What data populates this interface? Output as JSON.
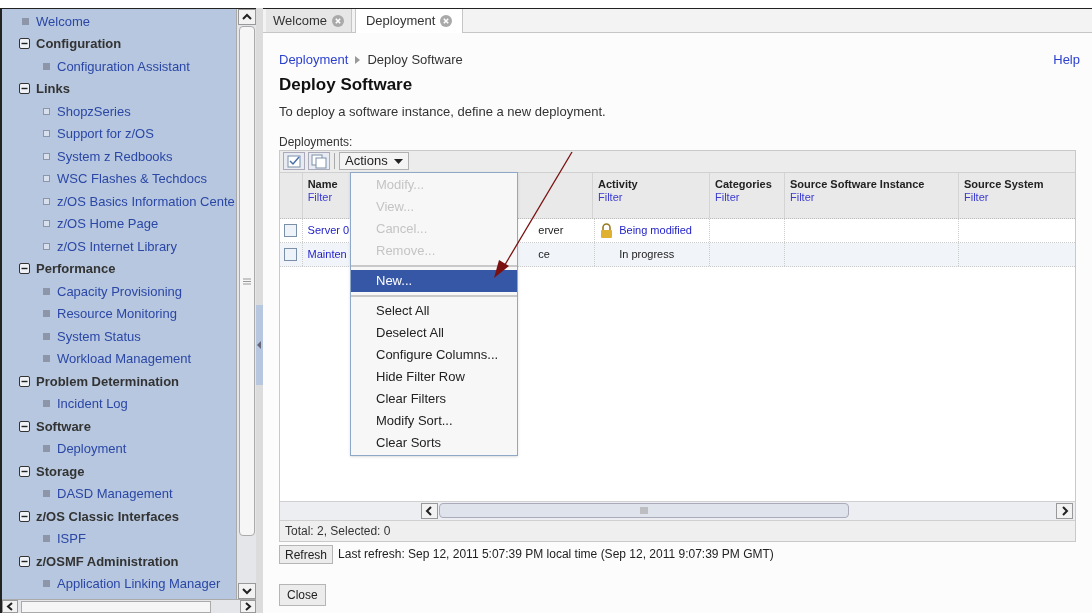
{
  "sidebar": {
    "items": [
      {
        "kind": "page",
        "label": "Welcome"
      },
      {
        "kind": "group",
        "label": "Configuration",
        "expanded": true,
        "children": [
          {
            "kind": "page",
            "label": "Configuration Assistant"
          }
        ]
      },
      {
        "kind": "group",
        "label": "Links",
        "expanded": true,
        "children": [
          {
            "kind": "link",
            "label": "ShopzSeries"
          },
          {
            "kind": "link",
            "label": "Support for z/OS"
          },
          {
            "kind": "link",
            "label": "System z Redbooks"
          },
          {
            "kind": "link",
            "label": "WSC Flashes & Techdocs"
          },
          {
            "kind": "link",
            "label": "z/OS Basics Information Cente"
          },
          {
            "kind": "link",
            "label": "z/OS Home Page"
          },
          {
            "kind": "link",
            "label": "z/OS Internet Library"
          }
        ]
      },
      {
        "kind": "group",
        "label": "Performance",
        "expanded": true,
        "children": [
          {
            "kind": "page",
            "label": "Capacity Provisioning"
          },
          {
            "kind": "page",
            "label": "Resource Monitoring"
          },
          {
            "kind": "page",
            "label": "System Status"
          },
          {
            "kind": "page",
            "label": "Workload Management"
          }
        ]
      },
      {
        "kind": "group",
        "label": "Problem Determination",
        "expanded": true,
        "children": [
          {
            "kind": "page",
            "label": "Incident Log"
          }
        ]
      },
      {
        "kind": "group",
        "label": "Software",
        "expanded": true,
        "children": [
          {
            "kind": "page",
            "label": "Deployment"
          }
        ]
      },
      {
        "kind": "group",
        "label": "Storage",
        "expanded": true,
        "children": [
          {
            "kind": "page",
            "label": "DASD Management"
          }
        ]
      },
      {
        "kind": "group",
        "label": "z/OS Classic Interfaces",
        "expanded": true,
        "children": [
          {
            "kind": "page",
            "label": "ISPF"
          }
        ]
      },
      {
        "kind": "group",
        "label": "z/OSMF Administration",
        "expanded": true,
        "children": [
          {
            "kind": "page",
            "label": "Application Linking Manager"
          }
        ]
      }
    ]
  },
  "tabs": [
    {
      "label": "Welcome",
      "selected": false
    },
    {
      "label": "Deployment",
      "selected": true
    }
  ],
  "breadcrumb": {
    "parent": "Deployment",
    "current": "Deploy Software"
  },
  "help": "Help",
  "title": "Deploy Software",
  "description": "To deploy a software instance, define a new deployment.",
  "table": {
    "label": "Deployments:",
    "actions": "Actions",
    "columns": [
      {
        "label": "Name",
        "filter": "Filter"
      },
      {
        "label": "Activity",
        "filter": "Filter"
      },
      {
        "label": "Categories",
        "filter": "Filter"
      },
      {
        "label": "Source Software Instance",
        "filter": "Filter"
      },
      {
        "label": "Source System",
        "filter": "Filter"
      }
    ],
    "rows": [
      {
        "selected": false,
        "name": "Server 0",
        "column_2": "erver",
        "activity": "Being modified",
        "locked": true
      },
      {
        "selected": false,
        "name": "Mainten",
        "column_2": "ce",
        "activity": "In progress",
        "locked": false
      }
    ],
    "status": "Total: 2, Selected: 0"
  },
  "menu": {
    "items": [
      {
        "kind": "item",
        "label": "Modify...",
        "disabled": true,
        "selected": false
      },
      {
        "kind": "item",
        "label": "View...",
        "disabled": true,
        "selected": false
      },
      {
        "kind": "item",
        "label": "Cancel...",
        "disabled": true,
        "selected": false
      },
      {
        "kind": "item",
        "label": "Remove...",
        "disabled": true,
        "selected": false
      },
      {
        "kind": "separator"
      },
      {
        "kind": "item",
        "label": "New...",
        "disabled": false,
        "selected": true
      },
      {
        "kind": "separator"
      },
      {
        "kind": "item",
        "label": "Select All",
        "disabled": false,
        "selected": false
      },
      {
        "kind": "item",
        "label": "Deselect All",
        "disabled": false,
        "selected": false
      },
      {
        "kind": "item",
        "label": "Configure Columns...",
        "disabled": false,
        "selected": false
      },
      {
        "kind": "item",
        "label": "Hide Filter Row",
        "disabled": false,
        "selected": false
      },
      {
        "kind": "item",
        "label": "Clear Filters",
        "disabled": false,
        "selected": false
      },
      {
        "kind": "item",
        "label": "Modify Sort...",
        "disabled": false,
        "selected": false
      },
      {
        "kind": "item",
        "label": "Clear Sorts",
        "disabled": false,
        "selected": false
      }
    ]
  },
  "refresh": {
    "button": "Refresh",
    "text": "Last refresh: Sep 12, 2011 5:07:39 PM local time (Sep 12, 2011 9:07:39 PM GMT)"
  },
  "close": "Close"
}
